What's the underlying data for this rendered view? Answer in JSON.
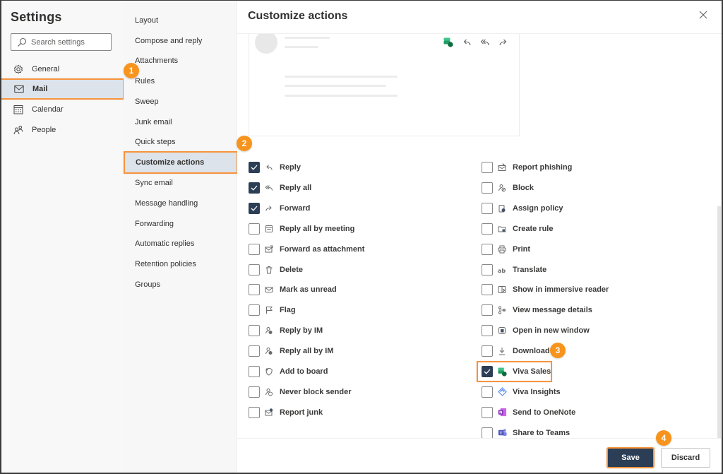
{
  "settings": {
    "title": "Settings",
    "search_placeholder": "Search settings",
    "nav": [
      {
        "label": "General",
        "icon": "gear-icon",
        "selected": false
      },
      {
        "label": "Mail",
        "icon": "mail-icon",
        "selected": true
      },
      {
        "label": "Calendar",
        "icon": "calendar-icon",
        "selected": false
      },
      {
        "label": "People",
        "icon": "people-icon",
        "selected": false
      }
    ]
  },
  "mail_settings": {
    "items": [
      {
        "label": "Layout"
      },
      {
        "label": "Compose and reply"
      },
      {
        "label": "Attachments"
      },
      {
        "label": "Rules"
      },
      {
        "label": "Sweep"
      },
      {
        "label": "Junk email"
      },
      {
        "label": "Quick steps"
      },
      {
        "label": "Customize actions",
        "selected": true
      },
      {
        "label": "Sync email"
      },
      {
        "label": "Message handling"
      },
      {
        "label": "Forwarding"
      },
      {
        "label": "Automatic replies"
      },
      {
        "label": "Retention policies"
      },
      {
        "label": "Groups"
      }
    ]
  },
  "main": {
    "title": "Customize actions",
    "close_icon": "close-icon",
    "preview_actions": [
      "viva-sales-icon",
      "reply-icon",
      "reply-all-icon",
      "forward-icon"
    ],
    "actions_left": [
      {
        "label": "Reply",
        "icon": "reply-icon",
        "checked": true
      },
      {
        "label": "Reply all",
        "icon": "reply-all-icon",
        "checked": true
      },
      {
        "label": "Forward",
        "icon": "forward-icon",
        "checked": true
      },
      {
        "label": "Reply all by meeting",
        "icon": "meeting-icon",
        "checked": false
      },
      {
        "label": "Forward as attachment",
        "icon": "forward-attachment-icon",
        "checked": false
      },
      {
        "label": "Delete",
        "icon": "delete-icon",
        "checked": false
      },
      {
        "label": "Mark as unread",
        "icon": "mail-unread-icon",
        "checked": false
      },
      {
        "label": "Flag",
        "icon": "flag-icon",
        "checked": false
      },
      {
        "label": "Reply by IM",
        "icon": "reply-im-icon",
        "checked": false
      },
      {
        "label": "Reply all by IM",
        "icon": "reply-all-im-icon",
        "checked": false
      },
      {
        "label": "Add to board",
        "icon": "board-icon",
        "checked": false
      },
      {
        "label": "Never block sender",
        "icon": "never-block-icon",
        "checked": false
      },
      {
        "label": "Report junk",
        "icon": "report-junk-icon",
        "checked": false
      }
    ],
    "actions_right": [
      {
        "label": "Report phishing",
        "icon": "report-phishing-icon",
        "checked": false
      },
      {
        "label": "Block",
        "icon": "block-icon",
        "checked": false
      },
      {
        "label": "Assign policy",
        "icon": "policy-icon",
        "checked": false
      },
      {
        "label": "Create rule",
        "icon": "rule-icon",
        "checked": false
      },
      {
        "label": "Print",
        "icon": "print-icon",
        "checked": false
      },
      {
        "label": "Translate",
        "icon": "translate-icon",
        "checked": false
      },
      {
        "label": "Show in immersive reader",
        "icon": "immersive-reader-icon",
        "checked": false
      },
      {
        "label": "View message details",
        "icon": "message-details-icon",
        "checked": false
      },
      {
        "label": "Open in new window",
        "icon": "new-window-icon",
        "checked": false
      },
      {
        "label": "Download",
        "icon": "download-icon",
        "checked": false
      },
      {
        "label": "Viva Sales",
        "icon": "viva-sales-icon",
        "checked": true
      },
      {
        "label": "Viva Insights",
        "icon": "viva-insights-icon",
        "checked": false
      },
      {
        "label": "Send to OneNote",
        "icon": "onenote-icon",
        "checked": false
      },
      {
        "label": "Share to Teams",
        "icon": "teams-icon",
        "checked": false
      }
    ],
    "save_label": "Save",
    "discard_label": "Discard"
  },
  "annotations": {
    "steps": [
      "1",
      "2",
      "3",
      "4"
    ],
    "highlight_color": "#f7943c",
    "badge_color": "#f7941d"
  },
  "colors": {
    "accent": "#2c3e55",
    "selected_bg": "#dde3ea"
  }
}
